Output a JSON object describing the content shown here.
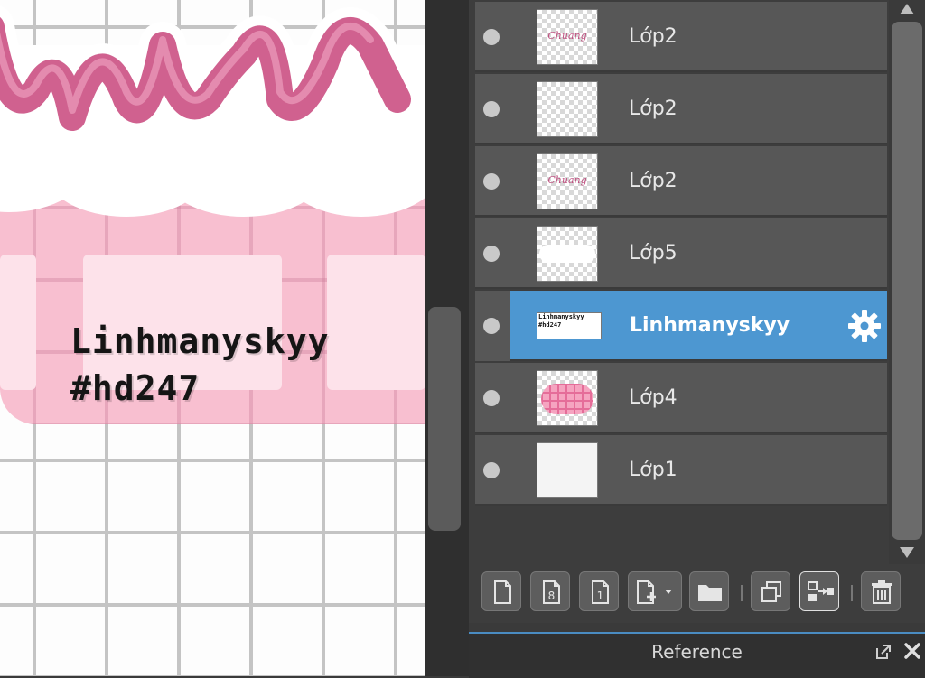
{
  "canvas": {
    "caption_line1": "Linhmanyskyy",
    "caption_line2": "#hd247"
  },
  "layers": [
    {
      "name": "Lớp2",
      "thumb": "text",
      "thumb_text": "Chuang"
    },
    {
      "name": "Lớp2",
      "thumb": "empty"
    },
    {
      "name": "Lớp2",
      "thumb": "text",
      "thumb_text": "Chuang"
    },
    {
      "name": "Lớp5",
      "thumb": "cloud"
    },
    {
      "name": "Linhmanyskyy",
      "thumb": "caption",
      "thumb_line1": "Linhmanyskyy",
      "thumb_line2": "#hd247",
      "selected": true
    },
    {
      "name": "Lớp4",
      "thumb": "mesh"
    },
    {
      "name": "Lớp1",
      "thumb": "white"
    }
  ],
  "toolbar": {
    "buttons": [
      "new-layer",
      "new-8bit-layer",
      "new-1bit-layer",
      "add-layer-menu",
      "new-folder",
      "duplicate-layer",
      "merge-down",
      "delete-layer"
    ]
  },
  "reference_panel": {
    "title": "Reference"
  },
  "colors": {
    "selection": "#4d97d1",
    "row": "#575757",
    "panel": "#3d3d3d",
    "canvas_pink": "#f8bfd0",
    "lettering_pink": "#d0618f"
  }
}
